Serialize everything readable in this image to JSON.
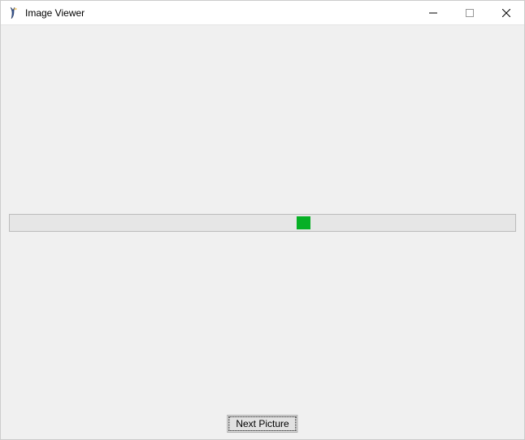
{
  "window": {
    "title": "Image Viewer"
  },
  "buttons": {
    "next": "Next Picture"
  }
}
